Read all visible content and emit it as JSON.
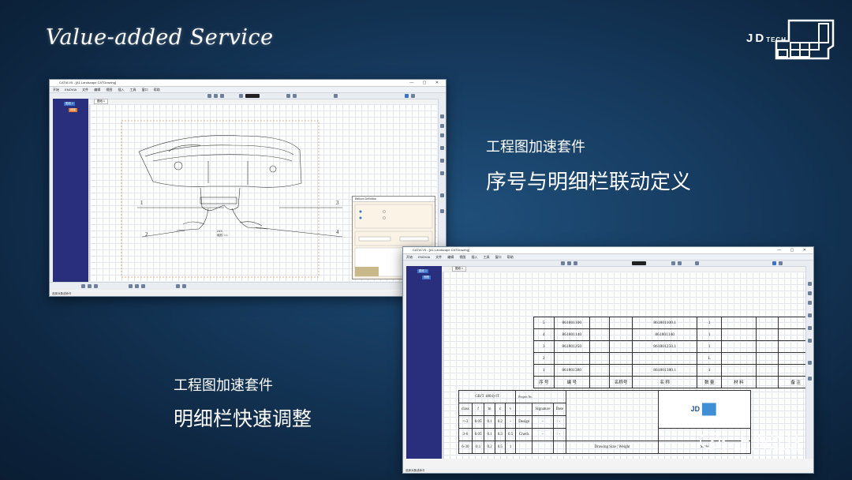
{
  "slide": {
    "headline": "Value-added Service",
    "logo": {
      "text": "JD",
      "sub": "TECH"
    },
    "caption_a_line1": "工程图加速套件",
    "caption_a_line2": "序号与明细栏联动定义",
    "caption_b_line1": "工程图加速套件",
    "caption_b_line2": "明细栏快速调整",
    "wechat_label": "上海江达",
    "wechat_icon": "wechat-icon"
  },
  "window1": {
    "title": "CATIA V5 - [A1 Landscape.CATDrawing]",
    "tab": "图纸.1",
    "tree_root": "图纸.1",
    "tree_child": "视图",
    "balloons": [
      "1",
      "2",
      "3",
      "4"
    ],
    "view_label": "249",
    "view_sub": "缩放: 1:1",
    "dialog_title": "Balloon Definition",
    "status": "选择对象或命令"
  },
  "window2": {
    "title": "CATIA V5 - [A1 Landscape.CATDrawing]",
    "tab": "图纸.1",
    "tree_root": "图纸.1",
    "tree_child": "视图",
    "status": "选择对象或命令",
    "bom_rows": [
      [
        "5",
        "861801100",
        "",
        "",
        "861801100.1",
        "1",
        "",
        "",
        ""
      ],
      [
        "4",
        "861801140",
        "",
        "",
        "861801140",
        "1",
        "",
        "",
        ""
      ],
      [
        "3",
        "861801250",
        "",
        "",
        "861801250.1",
        "1",
        "",
        "",
        ""
      ],
      [
        "2",
        "",
        "",
        "",
        "",
        "L",
        "",
        "",
        ""
      ],
      [
        "1",
        "861801380",
        "",
        "",
        "861801380.1",
        "1",
        "",
        "",
        ""
      ]
    ],
    "bom_header": [
      "序 号",
      "编 号",
      "",
      "名称号",
      "名 称",
      "数 量",
      "材 料",
      "",
      "备 注"
    ],
    "tolerance_title": "GB/T 1804)-IT",
    "tolerance_head": [
      "class",
      "f",
      "m",
      "c",
      "v"
    ],
    "tolerance_rows": [
      [
        "<-3",
        "0.05",
        "0.1",
        "0.2",
        "-"
      ],
      [
        "3-6",
        "0.05",
        "0.1",
        "0.3",
        "0.5"
      ],
      [
        "6-30",
        "0.1",
        "0.2",
        "0.5",
        "1"
      ]
    ],
    "project_label": "Project Nr.",
    "sign_head": [
      "Signature",
      "Date"
    ],
    "sign_rows": [
      "Design",
      "Check"
    ],
    "drawing_size": "Drawing Size",
    "weight": "Weight",
    "scale": "Scale"
  }
}
